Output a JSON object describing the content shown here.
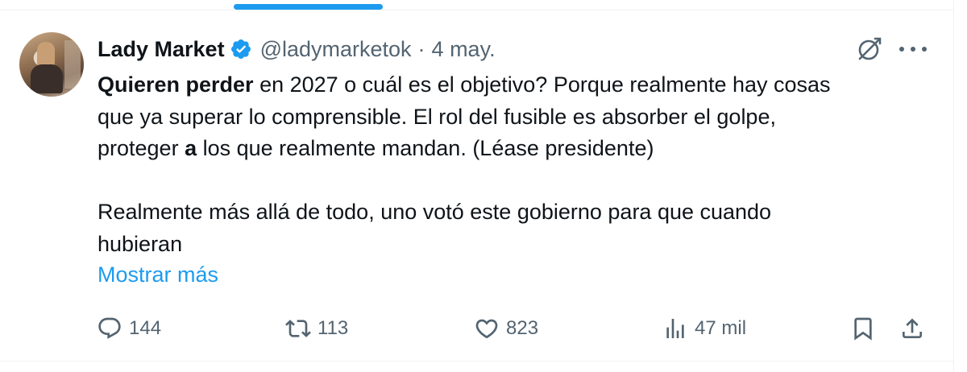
{
  "tweet": {
    "author": {
      "display_name": "Lady Market",
      "handle": "@ladymarketok",
      "verified": true
    },
    "separator": "·",
    "date": "4 may.",
    "text": {
      "line1_bold": "Quieren perder",
      "line1_rest": " en 2027 o cuál es el objetivo? Porque realmente hay cosas",
      "line2": "que ya superar lo comprensible. El rol del fusible es absorber el golpe,",
      "line3_start": "proteger ",
      "line3_bold": "a",
      "line3_end": " los que realmente mandan. (Léase presidente)",
      "line4": "Realmente más allá de todo, uno votó este gobierno para que cuando",
      "line5": "hubieran"
    },
    "show_more_label": "Mostrar más",
    "metrics": {
      "replies": "144",
      "reposts": "113",
      "likes": "823",
      "views": "47 mil"
    }
  },
  "colors": {
    "accent": "#1d9bf0",
    "text_primary": "#0f1419",
    "text_secondary": "#536471",
    "border": "#eff3f4"
  },
  "icons": {
    "verified": "verified-badge-icon",
    "grok": "grok-icon",
    "more": "more-icon",
    "reply": "reply-icon",
    "repost": "repost-icon",
    "like": "heart-icon",
    "views": "views-icon",
    "bookmark": "bookmark-icon",
    "share": "share-icon"
  }
}
